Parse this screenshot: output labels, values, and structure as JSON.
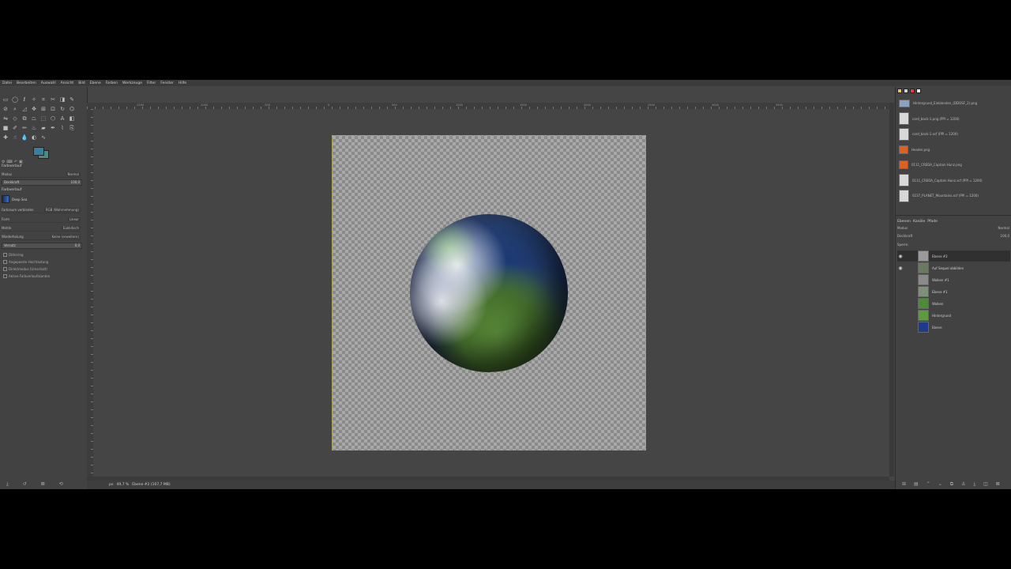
{
  "menu": [
    "Datei",
    "Bearbeiten",
    "Auswahl",
    "Ansicht",
    "Bild",
    "Ebene",
    "Farben",
    "Werkzeuge",
    "Filter",
    "Fenster",
    "Hilfe"
  ],
  "tool_options": {
    "title": "Farbverlauf",
    "mode_label": "Modus",
    "mode_value": "Normal",
    "opacity_label": "Deckkraft",
    "opacity_value": "100,0",
    "gradient_label": "Farbverlauf",
    "gradient_name": "Deep Sea",
    "blend_color_label": "Farbraum verbinden",
    "blend_color_value": "RGB (Wahrnehmung)",
    "shape_label": "Form",
    "shape_value": "Linear",
    "metric_label": "Metrik",
    "metric_value": "Euklidisch",
    "repeat_label": "Wiederholung",
    "repeat_value": "Keine (erweitern)",
    "offset_label": "Versatz",
    "offset_value": "0,0",
    "dithering_label": "Dithering",
    "check_adaptive": "Angepasste Hochtastung",
    "check_instant": "Direktmodus (Umschalt)",
    "check_modify": "Aktive Farbverlaufskanten"
  },
  "status": {
    "unit": "px",
    "zoom": "49,7 %",
    "layer_info": "Ebene #2 (107,7 MB)"
  },
  "images": [
    {
      "name": "Hintergrund_Einblenden_(DDOSF_2).png",
      "thumb": "blue"
    },
    {
      "name": "card_back-1.png (PPI = 1200)",
      "thumb": "white"
    },
    {
      "name": "card_back-1.xcf (PPI = 1200)",
      "thumb": "white"
    },
    {
      "name": "Header.png",
      "thumb": "orange"
    },
    {
      "name": "0111_CREDA_Captain Hunz.png",
      "thumb": "orange"
    },
    {
      "name": "0111_CREDA_Captain Hunz.xcf (PPI = 1200)",
      "thumb": "white"
    },
    {
      "name": "0237_PLANET_Mountains.xcf (PPI = 1200)",
      "thumb": "white"
    }
  ],
  "layers_panel": {
    "tabs": [
      "Ebenen",
      "Kanäle",
      "Pfade"
    ],
    "mode_label": "Modus",
    "mode_value": "Normal",
    "opacity_label": "Deckkraft",
    "opacity_value": "100,0",
    "lock_label": "Sperre:",
    "layers": [
      {
        "name": "Ebene #2",
        "visible": true,
        "color": "#9a9a9a",
        "active": true
      },
      {
        "name": "Auf Sequel abbilden",
        "visible": true,
        "color": "#6a7a60",
        "active": false
      },
      {
        "name": "Wolken #1",
        "visible": false,
        "color": "#8a8a8a",
        "active": false
      },
      {
        "name": "Ebene #1",
        "visible": false,
        "color": "#7f8f7a",
        "active": false
      },
      {
        "name": "Wolken",
        "visible": false,
        "color": "#4f8a3a",
        "active": false
      },
      {
        "name": "Hintergrund",
        "visible": false,
        "color": "#5e9a40",
        "active": false
      },
      {
        "name": "Ebene",
        "visible": false,
        "color": "#1e3a8a",
        "active": false
      }
    ]
  },
  "ruler_labels": [
    "-1500",
    "-1000",
    "-500",
    "0",
    "500",
    "1000",
    "1500",
    "2000",
    "2500",
    "3000",
    "3500"
  ],
  "colors": {
    "foreground": "#3a7fa0",
    "background": "#4e8a7c",
    "selection": "#b5a93a"
  }
}
